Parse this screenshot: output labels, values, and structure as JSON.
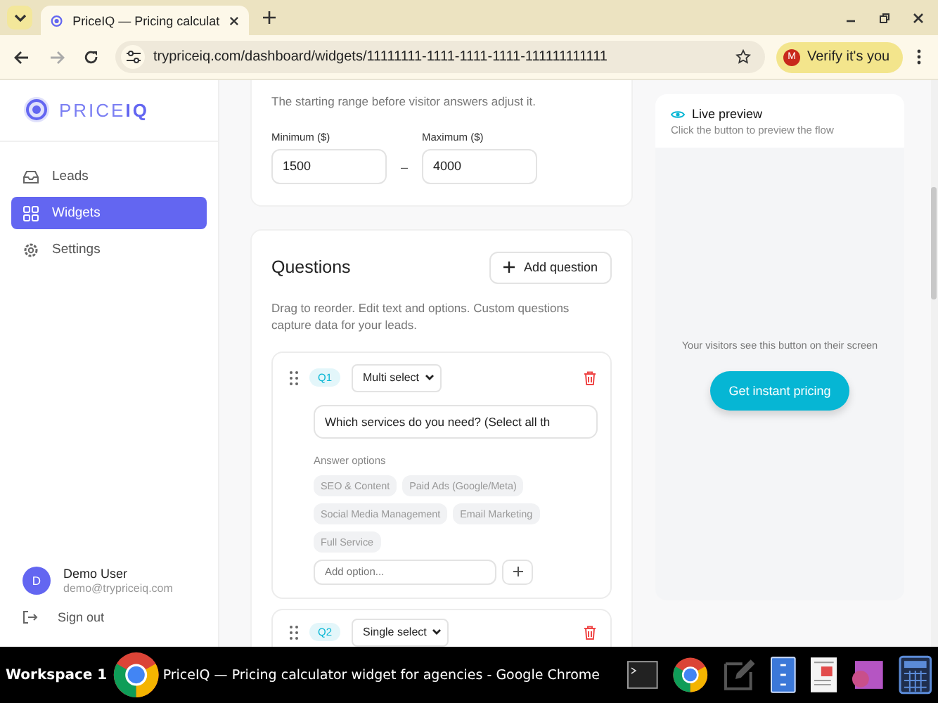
{
  "browser": {
    "tab_title": "PriceIQ — Pricing calculat",
    "url": "trypriceiq.com/dashboard/widgets/11111111-1111-1111-1111-111111111111",
    "verify_button": "Verify it's you",
    "verify_initial": "M"
  },
  "sidebar": {
    "logo": "PRICE**IQ**",
    "items": [
      {
        "label": "Leads",
        "selected": false
      },
      {
        "label": "Widgets",
        "selected": true
      },
      {
        "label": "Settings",
        "selected": false
      }
    ],
    "user": {
      "initial": "D",
      "name": "Demo User",
      "email": "demo@trypriceiq.com"
    },
    "sign_out": "Sign out"
  },
  "pricing": {
    "description": "The starting range before visitor answers adjust it.",
    "minimum": {
      "label": "Minimum ($)",
      "value": "1500"
    },
    "separator": "–",
    "maximum": {
      "label": "Maximum ($)",
      "value": "4000"
    }
  },
  "questions": {
    "title": "Questions",
    "add_button": "Add question",
    "description": "Drag to reorder. Edit text and options. Custom questions capture data for your leads.",
    "items": [
      {
        "number": "Q1",
        "type": "Multi select",
        "text": "Which services do you need? (Select all th",
        "options_label": "Answer options",
        "options": [
          "SEO & Content",
          "Paid Ads (Google/Meta)",
          "Social Media Management",
          "Email Marketing",
          "Full Service"
        ],
        "add_option_placeholder": "Add option..."
      },
      {
        "number": "Q2",
        "type": "Single select"
      }
    ]
  },
  "preview": {
    "title": "Live preview",
    "subtitle": "Click the button to preview the flow",
    "note": "Your visitors see this button on their screen",
    "button": "Get instant pricing"
  },
  "taskbar": {
    "workspace": "Workspace 1",
    "window_title": "PriceIQ — Pricing calculator widget for agencies - Google Chrome"
  }
}
